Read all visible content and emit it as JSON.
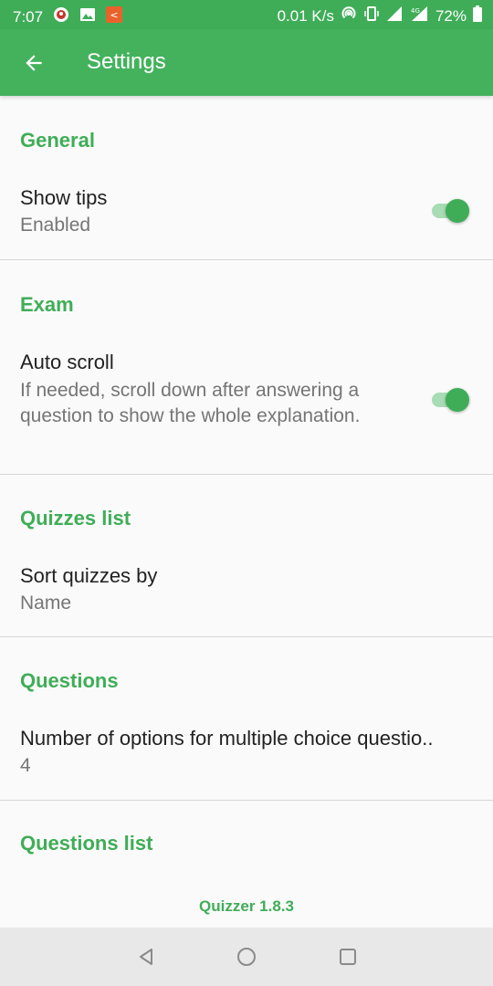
{
  "status_bar": {
    "time": "7:07",
    "speed": "0.01 K/s",
    "network": "4G",
    "battery": "72%"
  },
  "app_bar": {
    "title": "Settings",
    "back_icon": "arrow-left-icon"
  },
  "sections": [
    {
      "header": "General",
      "pref_title": "Show tips",
      "pref_summary": "Enabled",
      "switch_on": true
    },
    {
      "header": "Exam",
      "pref_title": "Auto scroll",
      "pref_summary": "If needed, scroll down after answering a question to show the whole explanation.",
      "switch_on": true
    },
    {
      "header": "Quizzes list",
      "pref_title": "Sort quizzes by",
      "pref_summary": "Name"
    },
    {
      "header": "Questions",
      "pref_title": "Number of options for multiple choice questio..",
      "pref_summary": "4"
    },
    {
      "header": "Questions list"
    }
  ],
  "footer": {
    "version": "Quizzer 1.8.3"
  },
  "colors": {
    "accent": "#3fad57",
    "app_bar": "#44b25d",
    "switch_track": "#a8dcb4"
  }
}
